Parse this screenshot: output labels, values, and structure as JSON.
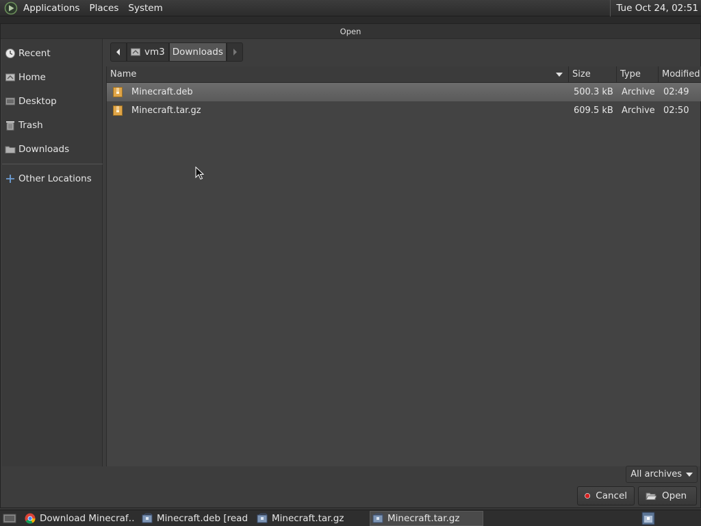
{
  "top_panel": {
    "menus": [
      "Applications",
      "Places",
      "System"
    ],
    "clock": "Tue Oct 24, 02:51"
  },
  "dialog": {
    "title": "Open",
    "sidebar": [
      {
        "label": "Recent",
        "icon": "clock-icon"
      },
      {
        "label": "Home",
        "icon": "home-icon"
      },
      {
        "label": "Desktop",
        "icon": "desktop-icon"
      },
      {
        "label": "Trash",
        "icon": "trash-icon"
      },
      {
        "label": "Downloads",
        "icon": "folder-icon"
      },
      {
        "label": "Other Locations",
        "icon": "plus-icon"
      }
    ],
    "path": [
      "vm3",
      "Downloads"
    ],
    "columns": {
      "name": "Name",
      "size": "Size",
      "type": "Type",
      "modified": "Modified"
    },
    "files": [
      {
        "name": "Minecraft.deb",
        "size": "500.3 kB",
        "type": "Archive",
        "modified": "02:49",
        "selected": true
      },
      {
        "name": "Minecraft.tar.gz",
        "size": "609.5 kB",
        "type": "Archive",
        "modified": "02:50",
        "selected": false
      }
    ],
    "filter": "All archives",
    "cancel": "Cancel",
    "open": "Open"
  },
  "taskbar": {
    "tasks": [
      {
        "label": "Download Minecraf…",
        "icon": "chrome-icon"
      },
      {
        "label": "Minecraft.deb [read …",
        "icon": "archive-manager-icon"
      },
      {
        "label": "Minecraft.tar.gz",
        "icon": "archive-manager-icon"
      },
      {
        "label": "Minecraft.tar.gz",
        "icon": "archive-manager-icon"
      }
    ]
  },
  "colors": {
    "selection": "#616161",
    "background": "#434343",
    "cancel_red": "#d42020"
  }
}
